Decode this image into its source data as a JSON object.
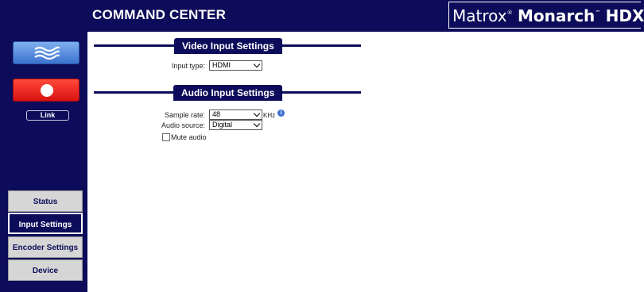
{
  "header": {
    "title": "COMMAND CENTER",
    "brand_matrox": "Matrox",
    "brand_reg": "®",
    "brand_monarch": "Monarch",
    "brand_tm": "™",
    "brand_hdx": "HDX"
  },
  "sidebar": {
    "link_label": "Link",
    "nav": [
      {
        "label": "Status"
      },
      {
        "label": "Input Settings"
      },
      {
        "label": "Encoder Settings"
      },
      {
        "label": "Device"
      }
    ]
  },
  "video_section": {
    "title": "Video Input Settings",
    "input_type_label": "Input type:",
    "input_type_value": "HDMI"
  },
  "audio_section": {
    "title": "Audio Input Settings",
    "sample_rate_label": "Sample rate:",
    "sample_rate_value": "48",
    "sample_rate_unit": "KHz",
    "info_glyph": "i",
    "audio_source_label": "Audio source:",
    "audio_source_value": "Digital",
    "mute_label": "Mute audio"
  },
  "colors": {
    "navy": "#0c0c5a",
    "stream_blue": "#4a84dc",
    "record_red": "#e61e1e"
  }
}
